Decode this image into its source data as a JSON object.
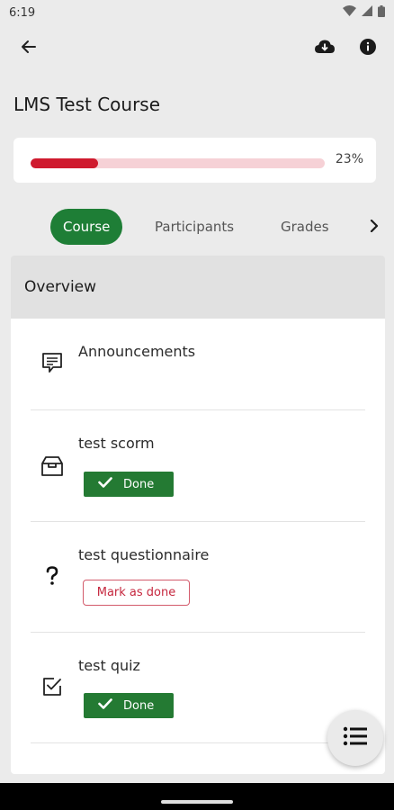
{
  "status": {
    "time": "6:19",
    "icons": [
      "wifi-icon",
      "signal-icon",
      "battery-icon"
    ]
  },
  "app_bar": {
    "back_icon": "arrow-left-icon",
    "actions": [
      "cloud-download-icon",
      "info-icon"
    ]
  },
  "course": {
    "title": "LMS Test Course",
    "progress_percent": 23,
    "progress_label": "23%"
  },
  "tabs": {
    "items": [
      "Course",
      "Participants",
      "Grades"
    ],
    "active": "Course",
    "more_icon": "chevron-right-icon"
  },
  "section": {
    "title": "Overview",
    "activities": [
      {
        "name": "Announcements",
        "icon": "forum-icon"
      },
      {
        "name": "test scorm",
        "icon": "package-icon",
        "status": "Done"
      },
      {
        "name": "test questionnaire",
        "icon": "question-icon",
        "action": "Mark as done"
      },
      {
        "name": "test quiz",
        "icon": "quiz-check-icon",
        "status": "Done"
      }
    ]
  },
  "fab": {
    "icon": "list-icon"
  },
  "colors": {
    "accent_green": "#1e7e36",
    "done_green": "#247a33",
    "progress_red": "#cf1a2e",
    "progress_track": "#f6d1d6",
    "mark_border": "#d35a6b"
  }
}
